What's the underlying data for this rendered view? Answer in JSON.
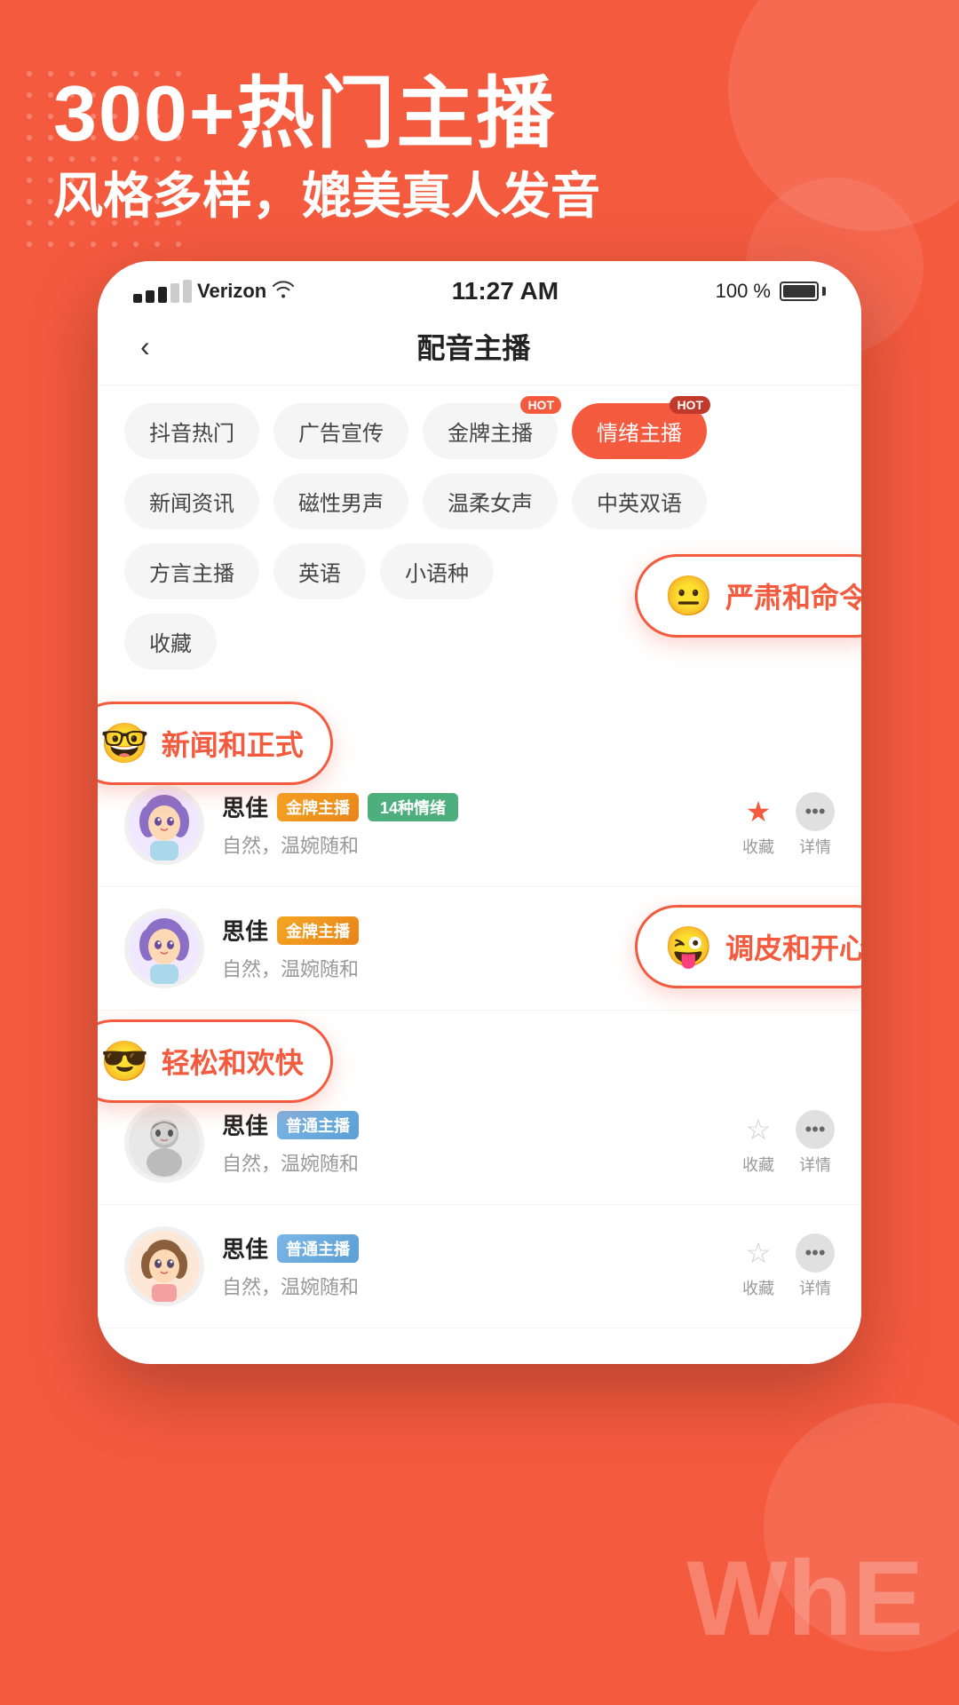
{
  "header": {
    "main_title": "300+热门主播",
    "sub_title": "风格多样，媲美真人发音"
  },
  "status_bar": {
    "carrier": "Verizon",
    "time": "11:27 AM",
    "battery_percent": "100 %"
  },
  "nav": {
    "title": "配音主播",
    "back_label": "<"
  },
  "filter_tags": [
    {
      "label": "抖音热门",
      "active": false,
      "badge": ""
    },
    {
      "label": "广告宣传",
      "active": false,
      "badge": ""
    },
    {
      "label": "金牌主播",
      "active": false,
      "badge": "HOT"
    },
    {
      "label": "情绪主播",
      "active": true,
      "badge": "HOT"
    },
    {
      "label": "新闻资讯",
      "active": false,
      "badge": ""
    },
    {
      "label": "磁性男声",
      "active": false,
      "badge": ""
    },
    {
      "label": "温柔女声",
      "active": false,
      "badge": ""
    },
    {
      "label": "中英双语",
      "active": false,
      "badge": ""
    },
    {
      "label": "方言主播",
      "active": false,
      "badge": ""
    },
    {
      "label": "英语",
      "active": false,
      "badge": ""
    },
    {
      "label": "小语种",
      "active": false,
      "badge": ""
    },
    {
      "label": "收藏",
      "active": false,
      "badge": ""
    }
  ],
  "tooltips": {
    "serious": {
      "emoji": "😐",
      "text": "严肃和命令"
    },
    "news": {
      "emoji": "🤓",
      "text": "新闻和正式"
    },
    "playful": {
      "emoji": "😜",
      "text": "调皮和开心"
    },
    "relaxed": {
      "emoji": "😎",
      "text": "轻松和欢快"
    }
  },
  "list_items": [
    {
      "id": 1,
      "name": "思佳",
      "badge": "金牌主播",
      "badge_type": "gold",
      "desc": "自然，温婉随和",
      "emotion_count": "14种情绪",
      "star_filled": true,
      "avatar_type": "anime_girl_purple"
    },
    {
      "id": 2,
      "name": "思佳",
      "badge": "金牌主播",
      "badge_type": "gold",
      "desc": "自然，温婉随和",
      "emotion_count": "",
      "star_filled": false,
      "avatar_type": "anime_girl_purple"
    },
    {
      "id": 3,
      "name": "思佳",
      "badge": "普通主播",
      "badge_type": "normal",
      "desc": "自然，温婉随和",
      "emotion_count": "",
      "star_filled": false,
      "avatar_type": "male_grey"
    },
    {
      "id": 4,
      "name": "思佳",
      "badge": "普通主播",
      "badge_type": "normal",
      "desc": "自然，温婉随和",
      "emotion_count": "",
      "star_filled": false,
      "avatar_type": "anime_girl_brown"
    }
  ],
  "actions": {
    "collect_label": "收藏",
    "detail_label": "详情"
  },
  "bottom_text": "WhE"
}
